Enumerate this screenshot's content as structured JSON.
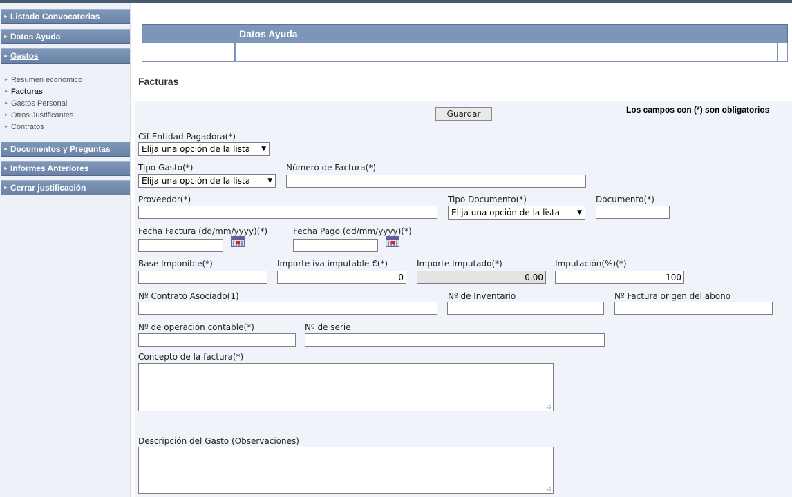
{
  "sidebar": {
    "menu": [
      {
        "label": "Listado Convocatorias"
      },
      {
        "label": "Datos Ayuda"
      },
      {
        "label": "Gastos"
      },
      {
        "label": "Documentos y Preguntas"
      },
      {
        "label": "Informes Anteriores"
      },
      {
        "label": "Cerrar justificación"
      }
    ],
    "submenu": [
      {
        "label": "Resumen económico"
      },
      {
        "label": "Facturas"
      },
      {
        "label": "Gastos Personal"
      },
      {
        "label": "Otros Justificantes"
      },
      {
        "label": "Contratos"
      }
    ]
  },
  "header": {
    "title": "Datos Ayuda"
  },
  "page": {
    "title": "Facturas"
  },
  "toolbar": {
    "save_label": "Guardar",
    "required_note": "Los campos con (*) son obligatorios"
  },
  "form": {
    "cif_label": "Cif Entidad Pagadora(*)",
    "cif_value": "Elija una opción de la lista",
    "tipo_gasto_label": "Tipo Gasto(*)",
    "tipo_gasto_value": "Elija una opción de la lista",
    "numero_factura_label": "Número de Factura(*)",
    "numero_factura_value": "",
    "proveedor_label": "Proveedor(*)",
    "proveedor_value": "",
    "tipo_documento_label": "Tipo Documento(*)",
    "tipo_documento_value": "Elija una opción de la lista",
    "documento_label": "Documento(*)",
    "documento_value": "",
    "fecha_factura_label": "Fecha Factura (dd/mm/yyyy)(*)",
    "fecha_factura_value": "",
    "fecha_pago_label": "Fecha Pago (dd/mm/yyyy)(*)",
    "fecha_pago_value": "",
    "base_imponible_label": "Base Imponible(*)",
    "base_imponible_value": "",
    "importe_iva_label": "Importe iva imputable €(*)",
    "importe_iva_value": "0",
    "importe_imputado_label": "Importe Imputado(*)",
    "importe_imputado_value": "0,00",
    "imputacion_label": "Imputación(%)(*)",
    "imputacion_value": "100",
    "contrato_label": "Nº Contrato Asociado(1)",
    "contrato_value": "",
    "inventario_label": "Nº de Inventario",
    "inventario_value": "",
    "factura_origen_label": "Nº Factura origen del abono",
    "factura_origen_value": "",
    "operacion_label": "Nº de operación contable(*)",
    "operacion_value": "",
    "serie_label": "Nº de serie",
    "serie_value": "",
    "concepto_label": "Concepto de la factura(*)",
    "descripcion_label": "Descripción del Gasto (Observaciones)"
  },
  "icons": {
    "calendar": "calendar-icon",
    "dropdown": "chevron-down-icon",
    "menu_arrow": "triangle-right-icon"
  }
}
